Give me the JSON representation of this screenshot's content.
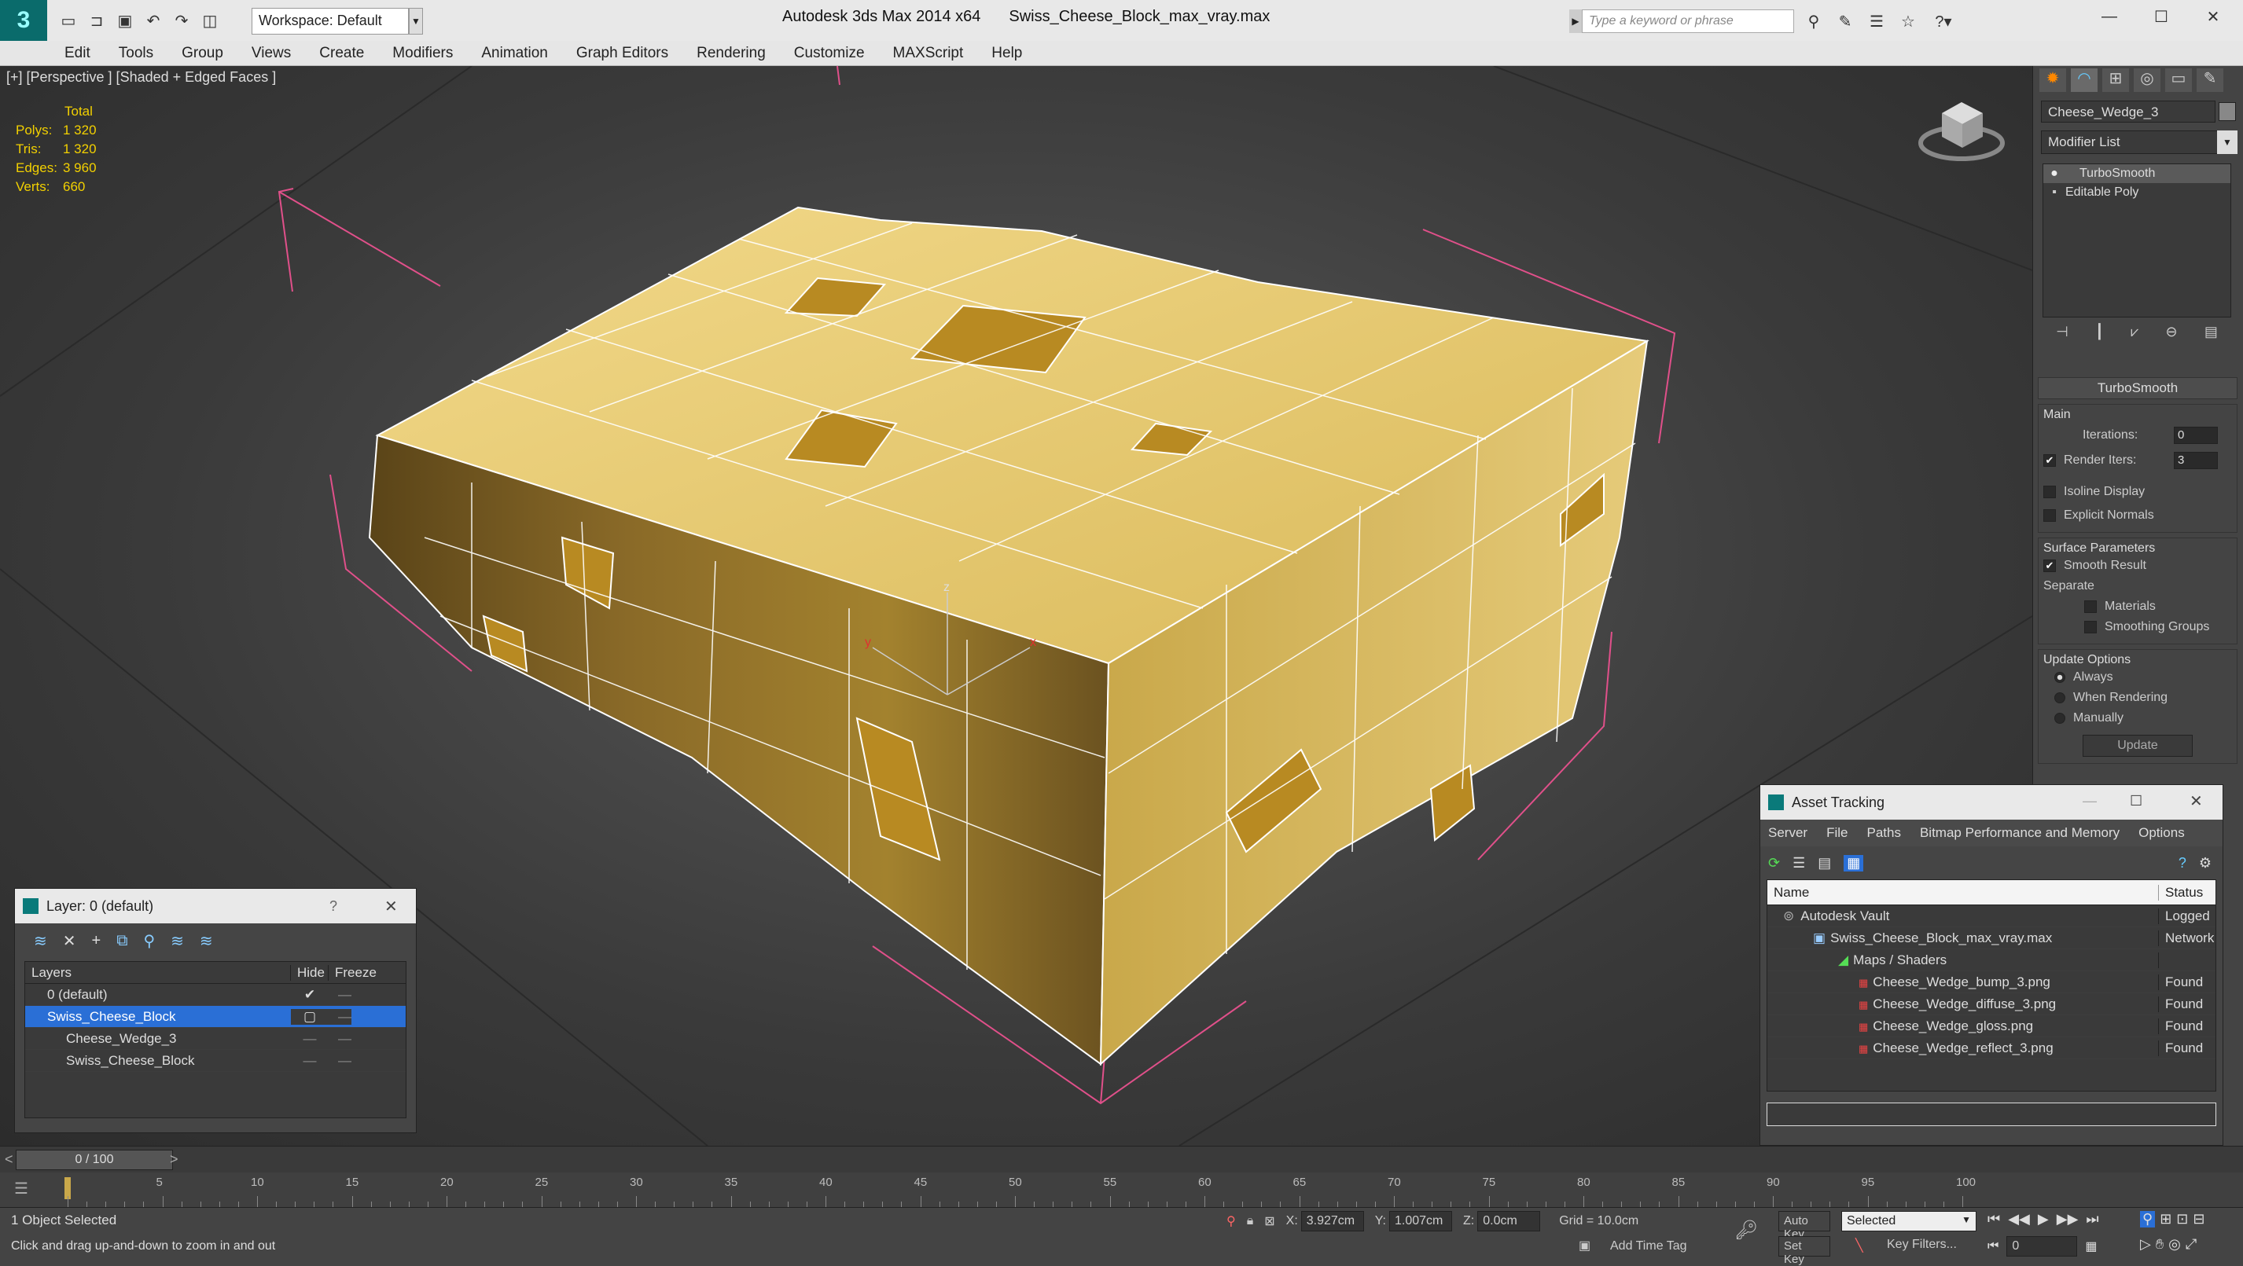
{
  "window": {
    "app_name": "Autodesk 3ds Max  2014 x64",
    "file_name": "Swiss_Cheese_Block_max_vray.max",
    "workspace": "Workspace: Default",
    "search_placeholder": "Type a keyword or phrase"
  },
  "menu": [
    "Edit",
    "Tools",
    "Group",
    "Views",
    "Create",
    "Modifiers",
    "Animation",
    "Graph Editors",
    "Rendering",
    "Customize",
    "MAXScript",
    "Help"
  ],
  "viewport": {
    "label": "[+] [Perspective ] [Shaded + Edged Faces ]",
    "stats": {
      "header": "Total",
      "rows": [
        {
          "k": "Polys:",
          "v": "1 320"
        },
        {
          "k": "Tris:",
          "v": "1 320"
        },
        {
          "k": "Edges:",
          "v": "3 960"
        },
        {
          "k": "Verts:",
          "v": "660"
        }
      ]
    },
    "axis_x": "x",
    "axis_y": "y",
    "axis_z": "z"
  },
  "command_panel": {
    "object_name": "Cheese_Wedge_3",
    "modifier_list": "Modifier List",
    "stack": [
      "TurboSmooth",
      "Editable Poly"
    ],
    "rollout_title": "TurboSmooth",
    "main_label": "Main",
    "iterations_label": "Iterations:",
    "iterations_value": "0",
    "render_iters_label": "Render Iters:",
    "render_iters_value": "3",
    "isoline": "Isoline Display",
    "explicit_normals": "Explicit Normals",
    "surface_params": "Surface Parameters",
    "smooth_result": "Smooth Result",
    "separate": "Separate",
    "materials": "Materials",
    "smoothing_groups": "Smoothing Groups",
    "update_options": "Update Options",
    "always": "Always",
    "when_rendering": "When Rendering",
    "manually": "Manually",
    "update_btn": "Update"
  },
  "layer_panel": {
    "title": "Layer: 0 (default)",
    "help": "?",
    "col_layers": "Layers",
    "col_hide": "Hide",
    "col_freeze": "Freeze",
    "rows": [
      "0 (default)",
      "Swiss_Cheese_Block",
      "Cheese_Wedge_3",
      "Swiss_Cheese_Block"
    ]
  },
  "asset_panel": {
    "title": "Asset Tracking",
    "menu": [
      "Server",
      "File",
      "Paths",
      "Bitmap Performance and Memory",
      "Options"
    ],
    "col_name": "Name",
    "col_status": "Status",
    "rows": [
      {
        "name": "Autodesk Vault",
        "status": "Logged"
      },
      {
        "name": "Swiss_Cheese_Block_max_vray.max",
        "status": "Network"
      },
      {
        "name": "Maps / Shaders",
        "status": ""
      },
      {
        "name": "Cheese_Wedge_bump_3.png",
        "status": "Found"
      },
      {
        "name": "Cheese_Wedge_diffuse_3.png",
        "status": "Found"
      },
      {
        "name": "Cheese_Wedge_gloss.png",
        "status": "Found"
      },
      {
        "name": "Cheese_Wedge_reflect_3.png",
        "status": "Found"
      }
    ]
  },
  "timeline": {
    "frame": "0 / 100",
    "prev": "<",
    "next": ">",
    "ticks": [
      "5",
      "10",
      "15",
      "20",
      "25",
      "30",
      "35",
      "40",
      "45",
      "50",
      "55",
      "60",
      "65",
      "70",
      "75",
      "80",
      "85",
      "90",
      "95",
      "100"
    ]
  },
  "status": {
    "selected": "1 Object Selected",
    "hint": "Click and drag up-and-down to zoom in and out",
    "x_label": "X:",
    "x": "3.927cm",
    "y_label": "Y:",
    "y": "1.007cm",
    "z_label": "Z:",
    "z": "0.0cm",
    "grid": "Grid = 10.0cm",
    "auto_key": "Auto Key",
    "set_key": "Set Key",
    "selected_dd": "Selected",
    "key_filters": "Key Filters...",
    "add_time_tag": "Add Time Tag",
    "frame_field": "0"
  }
}
